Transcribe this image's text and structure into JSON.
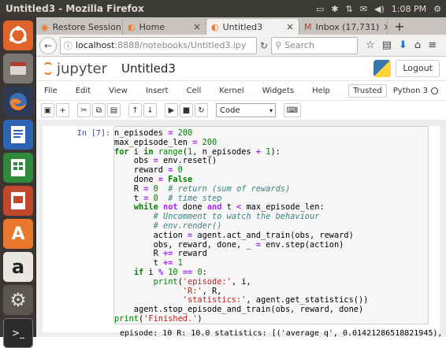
{
  "system_bar": {
    "window_title": "Untitled3 - Mozilla Firefox",
    "clock": "1:08 PM"
  },
  "browser": {
    "tabs": [
      {
        "label": "Restore Session",
        "icon": "firefox-icon",
        "active": false
      },
      {
        "label": "Home",
        "icon": "jupyter-icon",
        "active": false
      },
      {
        "label": "Untitled3",
        "icon": "jupyter-icon",
        "active": true
      },
      {
        "label": "Inbox (17,731)",
        "icon": "gmail-icon",
        "active": false
      }
    ],
    "url_host": "localhost",
    "url_path": ":8888/notebooks/Untitled3.ipy",
    "search_placeholder": "Search"
  },
  "jupyter": {
    "logo_text": "jupyter",
    "notebook_name": "Untitled3",
    "logout_label": "Logout",
    "menu": [
      "File",
      "Edit",
      "View",
      "Insert",
      "Cell",
      "Kernel",
      "Widgets",
      "Help"
    ],
    "trusted_label": "Trusted",
    "kernel_label": "Python 3",
    "cell_type": "Code"
  },
  "cell": {
    "prompt": "In [7]:",
    "output": "episode: 10 R: 10.0 statistics: [('average q', 0.01421286518821945),"
  },
  "colors": {
    "ubuntu_bar": "#3c3b37",
    "launcher": "#3b3633",
    "jupyter_orange": "#f37726",
    "prompt_blue": "#303f9f"
  }
}
